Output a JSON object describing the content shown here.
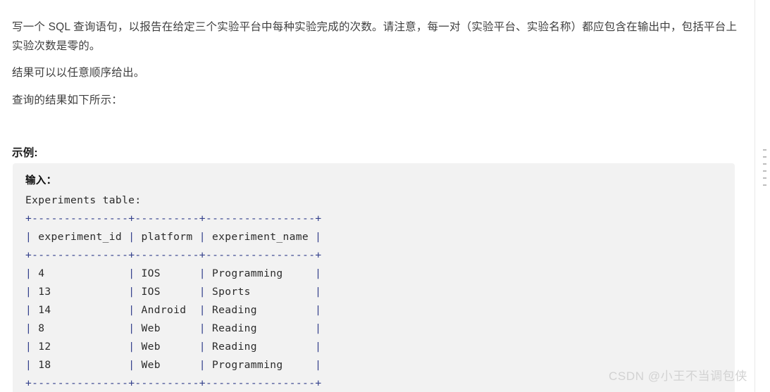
{
  "article": {
    "paragraphs": [
      "写一个 SQL 查询语句，以报告在给定三个实验平台中每种实验完成的次数。请注意，每一对（实验平台、实验名称）都应包含在输出中，包括平台上实验次数是零的。",
      "结果可以以任意顺序给出。",
      "查询的结果如下所示："
    ],
    "example_heading": "示例:"
  },
  "code_block": {
    "input_label": "输入：",
    "table_caption": "Experiments table:",
    "ascii_table": "+---------------+----------+-----------------+\n| experiment_id | platform | experiment_name |\n+---------------+----------+-----------------+\n| 4             | IOS      | Programming     |\n| 13            | IOS      | Sports          |\n| 14            | Android  | Reading         |\n| 8             | Web      | Reading         |\n| 12            | Web      | Reading         |\n| 18            | Web      | Programming     |\n+---------------+----------+-----------------+",
    "table_name": "Experiments",
    "columns": [
      "experiment_id",
      "platform",
      "experiment_name"
    ],
    "rows": [
      [
        "4",
        "IOS",
        "Programming"
      ],
      [
        "13",
        "IOS",
        "Sports"
      ],
      [
        "14",
        "Android",
        "Reading"
      ],
      [
        "8",
        "Web",
        "Reading"
      ],
      [
        "12",
        "Web",
        "Reading"
      ],
      [
        "18",
        "Web",
        "Programming"
      ]
    ]
  },
  "watermark": {
    "text": "CSDN @小王不当调包侠"
  },
  "colors": {
    "page_background": "#ffffff",
    "body_text": "#3f3f3f",
    "code_background": "#f2f2f2",
    "code_text": "#2b2b2b",
    "code_rule": "#33408c",
    "scrollbar_thumb": "#e9e9e9",
    "watermark": "#d2d2d2"
  }
}
